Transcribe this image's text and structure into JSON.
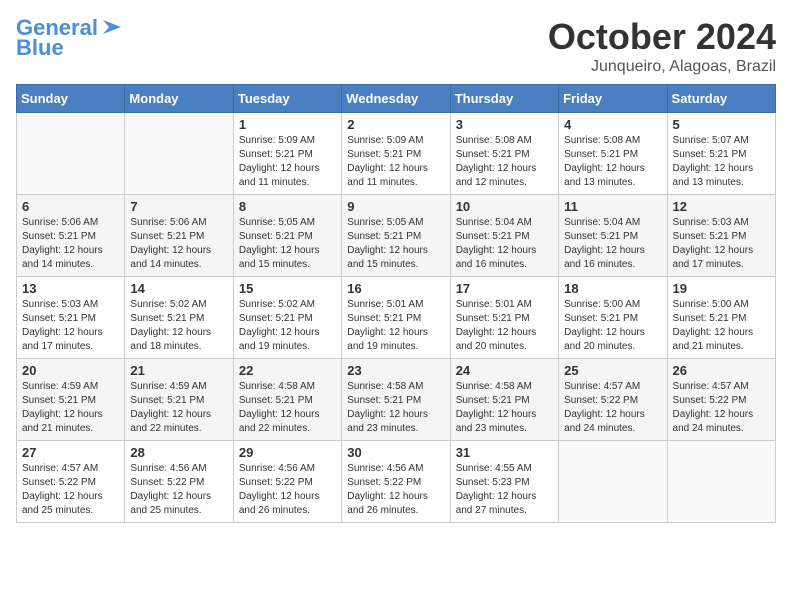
{
  "logo": {
    "line1": "General",
    "line2": "Blue"
  },
  "title": "October 2024",
  "subtitle": "Junqueiro, Alagoas, Brazil",
  "days_of_week": [
    "Sunday",
    "Monday",
    "Tuesday",
    "Wednesday",
    "Thursday",
    "Friday",
    "Saturday"
  ],
  "weeks": [
    [
      {
        "day": "",
        "info": ""
      },
      {
        "day": "",
        "info": ""
      },
      {
        "day": "1",
        "info": "Sunrise: 5:09 AM\nSunset: 5:21 PM\nDaylight: 12 hours and 11 minutes."
      },
      {
        "day": "2",
        "info": "Sunrise: 5:09 AM\nSunset: 5:21 PM\nDaylight: 12 hours and 11 minutes."
      },
      {
        "day": "3",
        "info": "Sunrise: 5:08 AM\nSunset: 5:21 PM\nDaylight: 12 hours and 12 minutes."
      },
      {
        "day": "4",
        "info": "Sunrise: 5:08 AM\nSunset: 5:21 PM\nDaylight: 12 hours and 13 minutes."
      },
      {
        "day": "5",
        "info": "Sunrise: 5:07 AM\nSunset: 5:21 PM\nDaylight: 12 hours and 13 minutes."
      }
    ],
    [
      {
        "day": "6",
        "info": "Sunrise: 5:06 AM\nSunset: 5:21 PM\nDaylight: 12 hours and 14 minutes."
      },
      {
        "day": "7",
        "info": "Sunrise: 5:06 AM\nSunset: 5:21 PM\nDaylight: 12 hours and 14 minutes."
      },
      {
        "day": "8",
        "info": "Sunrise: 5:05 AM\nSunset: 5:21 PM\nDaylight: 12 hours and 15 minutes."
      },
      {
        "day": "9",
        "info": "Sunrise: 5:05 AM\nSunset: 5:21 PM\nDaylight: 12 hours and 15 minutes."
      },
      {
        "day": "10",
        "info": "Sunrise: 5:04 AM\nSunset: 5:21 PM\nDaylight: 12 hours and 16 minutes."
      },
      {
        "day": "11",
        "info": "Sunrise: 5:04 AM\nSunset: 5:21 PM\nDaylight: 12 hours and 16 minutes."
      },
      {
        "day": "12",
        "info": "Sunrise: 5:03 AM\nSunset: 5:21 PM\nDaylight: 12 hours and 17 minutes."
      }
    ],
    [
      {
        "day": "13",
        "info": "Sunrise: 5:03 AM\nSunset: 5:21 PM\nDaylight: 12 hours and 17 minutes."
      },
      {
        "day": "14",
        "info": "Sunrise: 5:02 AM\nSunset: 5:21 PM\nDaylight: 12 hours and 18 minutes."
      },
      {
        "day": "15",
        "info": "Sunrise: 5:02 AM\nSunset: 5:21 PM\nDaylight: 12 hours and 19 minutes."
      },
      {
        "day": "16",
        "info": "Sunrise: 5:01 AM\nSunset: 5:21 PM\nDaylight: 12 hours and 19 minutes."
      },
      {
        "day": "17",
        "info": "Sunrise: 5:01 AM\nSunset: 5:21 PM\nDaylight: 12 hours and 20 minutes."
      },
      {
        "day": "18",
        "info": "Sunrise: 5:00 AM\nSunset: 5:21 PM\nDaylight: 12 hours and 20 minutes."
      },
      {
        "day": "19",
        "info": "Sunrise: 5:00 AM\nSunset: 5:21 PM\nDaylight: 12 hours and 21 minutes."
      }
    ],
    [
      {
        "day": "20",
        "info": "Sunrise: 4:59 AM\nSunset: 5:21 PM\nDaylight: 12 hours and 21 minutes."
      },
      {
        "day": "21",
        "info": "Sunrise: 4:59 AM\nSunset: 5:21 PM\nDaylight: 12 hours and 22 minutes."
      },
      {
        "day": "22",
        "info": "Sunrise: 4:58 AM\nSunset: 5:21 PM\nDaylight: 12 hours and 22 minutes."
      },
      {
        "day": "23",
        "info": "Sunrise: 4:58 AM\nSunset: 5:21 PM\nDaylight: 12 hours and 23 minutes."
      },
      {
        "day": "24",
        "info": "Sunrise: 4:58 AM\nSunset: 5:21 PM\nDaylight: 12 hours and 23 minutes."
      },
      {
        "day": "25",
        "info": "Sunrise: 4:57 AM\nSunset: 5:22 PM\nDaylight: 12 hours and 24 minutes."
      },
      {
        "day": "26",
        "info": "Sunrise: 4:57 AM\nSunset: 5:22 PM\nDaylight: 12 hours and 24 minutes."
      }
    ],
    [
      {
        "day": "27",
        "info": "Sunrise: 4:57 AM\nSunset: 5:22 PM\nDaylight: 12 hours and 25 minutes."
      },
      {
        "day": "28",
        "info": "Sunrise: 4:56 AM\nSunset: 5:22 PM\nDaylight: 12 hours and 25 minutes."
      },
      {
        "day": "29",
        "info": "Sunrise: 4:56 AM\nSunset: 5:22 PM\nDaylight: 12 hours and 26 minutes."
      },
      {
        "day": "30",
        "info": "Sunrise: 4:56 AM\nSunset: 5:22 PM\nDaylight: 12 hours and 26 minutes."
      },
      {
        "day": "31",
        "info": "Sunrise: 4:55 AM\nSunset: 5:23 PM\nDaylight: 12 hours and 27 minutes."
      },
      {
        "day": "",
        "info": ""
      },
      {
        "day": "",
        "info": ""
      }
    ]
  ]
}
